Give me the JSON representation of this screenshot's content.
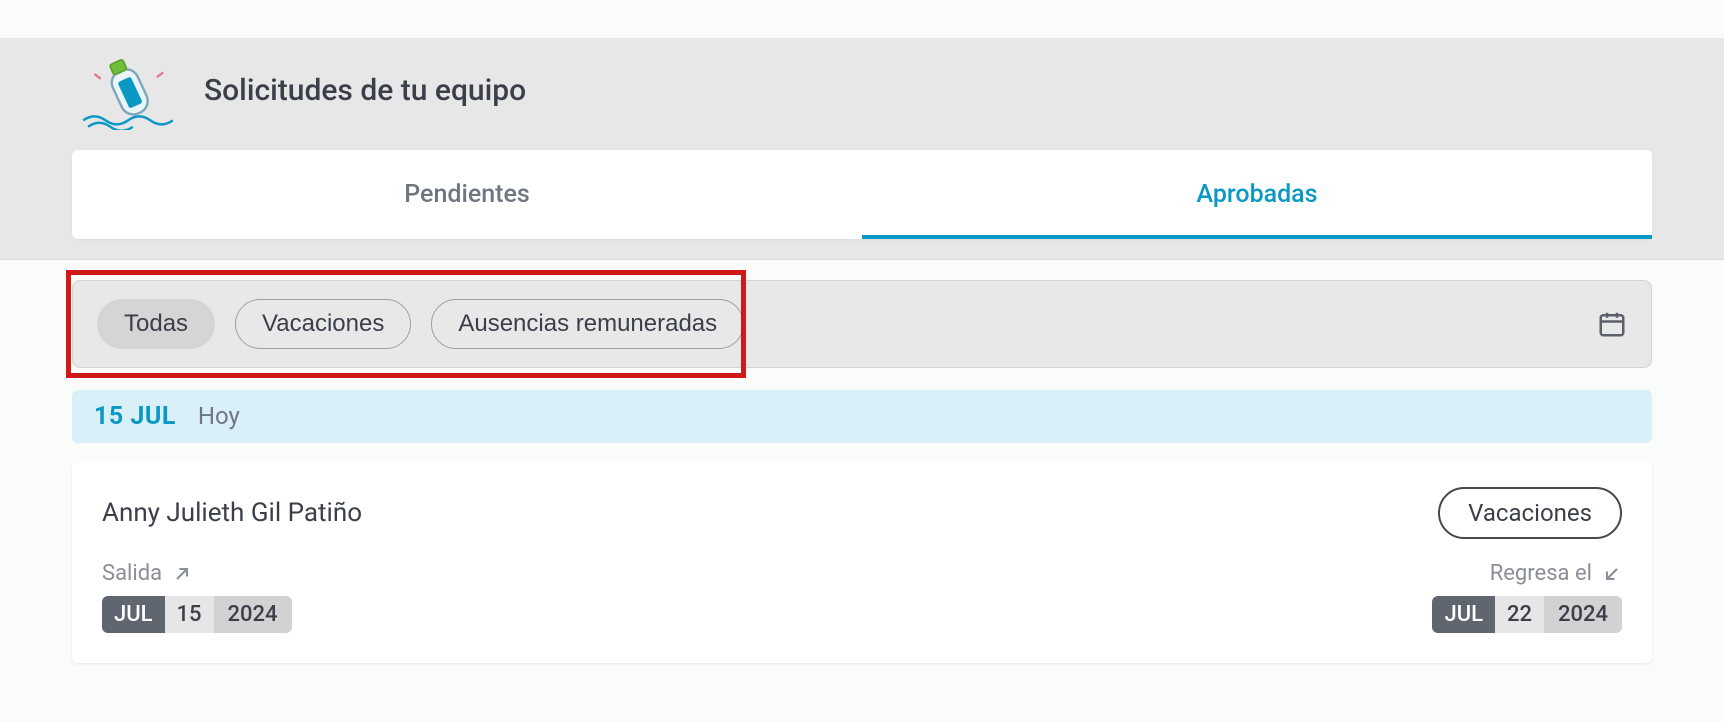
{
  "header": {
    "title": "Solicitudes de tu equipo"
  },
  "tabs": {
    "pending": "Pendientes",
    "approved": "Aprobadas"
  },
  "filters": {
    "all": "Todas",
    "vacations": "Vacaciones",
    "paid_absences": "Ausencias remuneradas"
  },
  "date_header": {
    "date": "15 JUL",
    "label": "Hoy"
  },
  "request": {
    "name": "Anny Julieth Gil Patiño",
    "type_label": "Vacaciones",
    "departure": {
      "label": "Salida",
      "month": "JUL",
      "day": "15",
      "year": "2024"
    },
    "return": {
      "label": "Regresa el",
      "month": "JUL",
      "day": "22",
      "year": "2024"
    }
  }
}
